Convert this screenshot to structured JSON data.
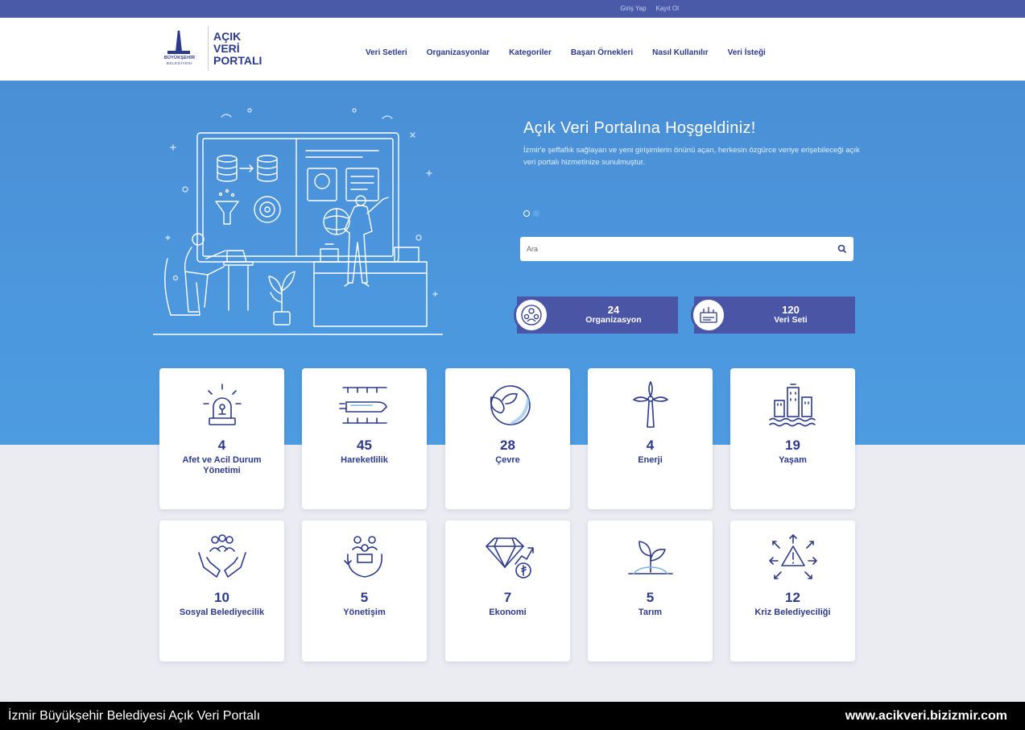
{
  "topbar": {
    "login": "Giriş Yap",
    "register": "Kayıt Ol"
  },
  "logo": {
    "line1": "AÇIK",
    "line2": "VERİ",
    "line3": "PORTALI",
    "emblem_text1": "BÜYÜKŞEHİR",
    "emblem_text2": "BELEDİYESİ"
  },
  "nav": [
    "Veri Setleri",
    "Organizasyonlar",
    "Kategoriler",
    "Başarı Örnekleri",
    "Nasıl Kullanılır",
    "Veri İsteği"
  ],
  "hero": {
    "title": "Açık Veri Portalına Hoşgeldiniz!",
    "text": "İzmir'e şeffaflık sağlayan ve yeni girişimlerin önünü açan, herkesin özgürce veriye erişebileceği açık veri portalı hizmetinize sunulmuştur.",
    "carousel_slides": 2,
    "carousel_active": 1
  },
  "search": {
    "placeholder": "Ara"
  },
  "stats": [
    {
      "count": "24",
      "label": "Organizasyon",
      "icon": "organization-icon"
    },
    {
      "count": "120",
      "label": "Veri Seti",
      "icon": "dataset-icon"
    }
  ],
  "categories": [
    {
      "count": "4",
      "label": "Afet ve Acil Durum Yönetimi",
      "icon": "siren-icon"
    },
    {
      "count": "45",
      "label": "Hareketlilik",
      "icon": "train-icon"
    },
    {
      "count": "28",
      "label": "Çevre",
      "icon": "globe-leaf-icon"
    },
    {
      "count": "4",
      "label": "Enerji",
      "icon": "wind-turbine-icon"
    },
    {
      "count": "19",
      "label": "Yaşam",
      "icon": "city-icon"
    },
    {
      "count": "10",
      "label": "Sosyal Belediyecilik",
      "icon": "hands-people-icon"
    },
    {
      "count": "5",
      "label": "Yönetişim",
      "icon": "governance-icon"
    },
    {
      "count": "7",
      "label": "Ekonomi",
      "icon": "diamond-lira-icon"
    },
    {
      "count": "5",
      "label": "Tarım",
      "icon": "sprout-icon"
    },
    {
      "count": "12",
      "label": "Kriz Belediyeciliği",
      "icon": "crisis-icon"
    }
  ],
  "footer": {
    "left": "İzmir Büyükşehir Belediyesi Açık Veri Portalı",
    "right": "www.acikveri.bizizmir.com"
  },
  "colors": {
    "topbar": "#4a5aa8",
    "hero": "#4a8fd6",
    "navy": "#2d3a8c",
    "stat": "#4a55a6",
    "page": "#ebebf2"
  }
}
